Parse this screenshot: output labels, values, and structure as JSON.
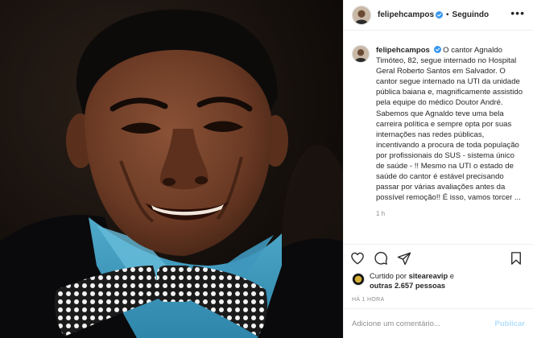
{
  "post": {
    "image_alt": "",
    "author": {
      "username": "felipehcampos",
      "verified": true
    },
    "follow_status": "Seguindo",
    "header_separator": "•",
    "more_options": "•••",
    "caption": {
      "username": "felipehcampos",
      "text": "O cantor Agnaldo Timóteo, 82, segue internado no Hospital Geral Roberto Santos em Salvador. O cantor segue internado na UTI da unidade pública baiana e, magnificamente assistido pela equipe do médico Doutor André. Sabemos que Agnaldo teve uma bela carreira política e sempre opta por suas internações nas redes públicas, incentivando a procura de toda população por profissionais do SUS - sistema único de saúde - !! Mesmo na UTI o estado de saúde do cantor é estável precisando passar por várias avaliações antes da possível remoção!! É isso, vamos torcer ...",
      "time": "1 h"
    },
    "actions": {
      "like_icon": "heart-icon",
      "comment_icon": "comment-icon",
      "share_icon": "share-icon",
      "save_icon": "bookmark-icon"
    },
    "likes": {
      "prefix": "Curtido por",
      "user": "siteareavip",
      "middle": "e",
      "others": "outras 2.657 pessoas"
    },
    "timestamp": "HÁ 1 HORA",
    "comment_box": {
      "placeholder": "Adicione um comentário...",
      "publish_label": "Publicar"
    }
  },
  "colors": {
    "verified": "#3897f0",
    "publish_disabled": "#b2dffc",
    "muted": "#8e8e8e",
    "text": "#262626",
    "border": "#efefef"
  }
}
